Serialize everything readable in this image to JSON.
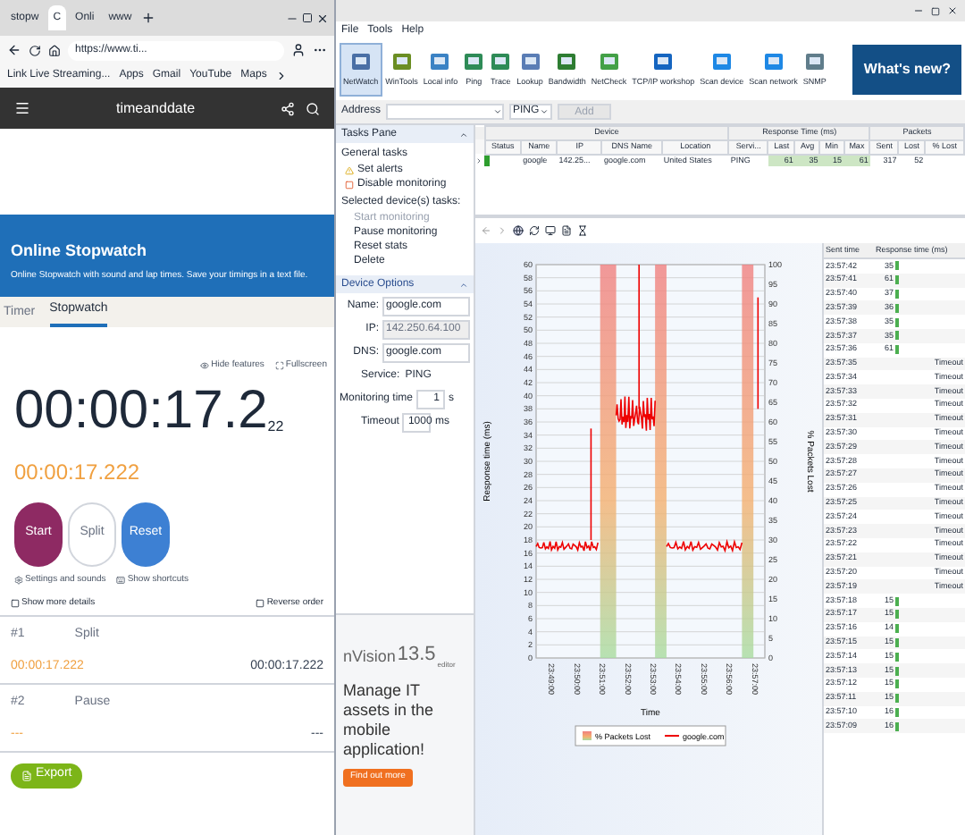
{
  "browser": {
    "tabs": [
      {
        "label": "stopw",
        "selected": false
      },
      {
        "label": "C",
        "selected": true
      },
      {
        "label": "Onli",
        "selected": false
      },
      {
        "label": "www",
        "selected": false
      }
    ],
    "address": "https://www.ti...",
    "bookmarks": [
      "Link Live Streaming...",
      "Apps",
      "Gmail",
      "YouTube",
      "Maps"
    ],
    "site_logo": "timeanddate"
  },
  "stopwatch": {
    "title": "Online Stopwatch",
    "subtitle": "Online Stopwatch with sound and lap times. Save your timings in a text file.",
    "tabs": [
      {
        "label": "Timer",
        "selected": false
      },
      {
        "label": "Stopwatch",
        "selected": true
      }
    ],
    "links": [
      "Hide features",
      "Fullscreen"
    ],
    "time": "00:00:17.2",
    "time_small": "22",
    "lap_time": "00:00:17.222",
    "buttons": [
      {
        "label": "Start",
        "kind": "start"
      },
      {
        "label": "Split",
        "kind": "split"
      },
      {
        "label": "Reset",
        "kind": "reset"
      }
    ],
    "settings_links": [
      "Settings and sounds",
      "Show shortcuts"
    ],
    "options": [
      {
        "label": "Show more details",
        "checked": false
      },
      {
        "label": "Reverse order",
        "checked": false
      }
    ],
    "laps": [
      {
        "number": "#1",
        "name": "Split",
        "time": "00:00:17.222",
        "total": "00:00:17.222"
      },
      {
        "number": "#2",
        "name": "Pause",
        "time": "---",
        "total": "---"
      }
    ],
    "export": "Export"
  },
  "app": {
    "menu": [
      "File",
      "Tools",
      "Help"
    ],
    "toolbar": [
      {
        "label": "NetWatch",
        "selected": true
      },
      {
        "label": "WinTools",
        "selected": false
      },
      {
        "label": "Local info",
        "selected": false
      },
      {
        "label": "Ping",
        "selected": false
      },
      {
        "label": "Trace",
        "selected": false
      },
      {
        "label": "Lookup",
        "selected": false
      },
      {
        "label": "Bandwidth",
        "selected": false
      },
      {
        "label": "NetCheck",
        "selected": false
      },
      {
        "label": "TCP/IP workshop",
        "selected": false
      },
      {
        "label": "Scan device",
        "selected": false
      },
      {
        "label": "Scan network",
        "selected": false
      },
      {
        "label": "SNMP",
        "selected": false
      }
    ],
    "whats_new": "What's new?",
    "address_label": "Address",
    "service": "PING",
    "add_button": "Add",
    "tasks": {
      "header": "Tasks Pane",
      "general": "General tasks",
      "general_items": [
        "Set alerts",
        "Disable monitoring"
      ],
      "selected": "Selected device(s) tasks:",
      "selected_items": [
        {
          "label": "Start monitoring",
          "disabled": true
        },
        {
          "label": "Pause monitoring",
          "disabled": false
        },
        {
          "label": "Reset stats",
          "disabled": false
        },
        {
          "label": "Delete",
          "disabled": false
        }
      ]
    },
    "options": {
      "header": "Device Options",
      "name_label": "Name:",
      "name": "google.com",
      "ip_label": "IP:",
      "ip": "142.250.64.100",
      "dns_label": "DNS:",
      "dns": "google.com",
      "service_label": "Service:",
      "service": "PING",
      "monitoring_label": "Monitoring time",
      "monitoring": "1",
      "monitoring_unit": "s",
      "timeout_label": "Timeout",
      "timeout": "1000",
      "timeout_unit": "ms"
    },
    "ad": {
      "brand": "nVision",
      "version": "13.5",
      "edition": "editor",
      "text": "Manage IT assets in the mobile application!",
      "button": "Find out more"
    },
    "device_table": {
      "groups": [
        "Device",
        "Response Time (ms)",
        "Packets"
      ],
      "columns": [
        "Status",
        "Name",
        "IP",
        "DNS Name",
        "Location",
        "Servi...",
        "Last",
        "Avg",
        "Min",
        "Max",
        "Sent",
        "Lost",
        "% Lost"
      ],
      "rows": [
        [
          "",
          "google",
          "142.25...",
          "google.com",
          "United States",
          "PING",
          "61",
          "35",
          "15",
          "61",
          "317",
          "52"
        ]
      ]
    },
    "chart": {
      "ylabel": "Response time (ms)",
      "y2label": "% Packets Lost",
      "xlabel": "Time",
      "yticks": [
        "60",
        "58",
        "56",
        "54",
        "52",
        "50",
        "48",
        "46",
        "44",
        "42",
        "40",
        "38",
        "36",
        "34",
        "32",
        "30",
        "28",
        "26",
        "24",
        "22",
        "20",
        "18",
        "16",
        "14",
        "12",
        "10",
        "8",
        "6",
        "4",
        "2",
        "0"
      ],
      "y2ticks": [
        "100",
        "95",
        "90",
        "85",
        "80",
        "75",
        "70",
        "65",
        "60",
        "55",
        "50",
        "45",
        "40",
        "35",
        "30",
        "25",
        "20",
        "15",
        "10",
        "5",
        "0"
      ],
      "xticks": [
        "23:49:00",
        "23:50:00",
        "23:51:00",
        "23:52:00",
        "23:53:00",
        "23:54:00",
        "23:55:00",
        "23:56:00",
        "23:57:00"
      ],
      "legend": [
        "% Packets Lost",
        "google.com"
      ]
    },
    "log": {
      "columns": [
        "Sent time",
        "Response time (ms)"
      ],
      "rows": [
        {
          "time": "23:57:42",
          "value": "35",
          "kind": "ok"
        },
        {
          "time": "23:57:41",
          "value": "61",
          "kind": "ok"
        },
        {
          "time": "23:57:40",
          "value": "37",
          "kind": "ok"
        },
        {
          "time": "23:57:39",
          "value": "36",
          "kind": "ok"
        },
        {
          "time": "23:57:38",
          "value": "35",
          "kind": "ok"
        },
        {
          "time": "23:57:37",
          "value": "35",
          "kind": "ok"
        },
        {
          "time": "23:57:36",
          "value": "61",
          "kind": "ok"
        },
        {
          "time": "23:57:35",
          "value": "Timeout",
          "kind": "timeout"
        },
        {
          "time": "23:57:34",
          "value": "Timeout",
          "kind": "timeout"
        },
        {
          "time": "23:57:33",
          "value": "Timeout",
          "kind": "timeout"
        },
        {
          "time": "23:57:32",
          "value": "Timeout",
          "kind": "timeout"
        },
        {
          "time": "23:57:31",
          "value": "Timeout",
          "kind": "timeout"
        },
        {
          "time": "23:57:30",
          "value": "Timeout",
          "kind": "timeout"
        },
        {
          "time": "23:57:29",
          "value": "Timeout",
          "kind": "timeout"
        },
        {
          "time": "23:57:28",
          "value": "Timeout",
          "kind": "timeout"
        },
        {
          "time": "23:57:27",
          "value": "Timeout",
          "kind": "timeout"
        },
        {
          "time": "23:57:26",
          "value": "Timeout",
          "kind": "timeout"
        },
        {
          "time": "23:57:25",
          "value": "Timeout",
          "kind": "timeout"
        },
        {
          "time": "23:57:24",
          "value": "Timeout",
          "kind": "timeout"
        },
        {
          "time": "23:57:23",
          "value": "Timeout",
          "kind": "timeout"
        },
        {
          "time": "23:57:22",
          "value": "Timeout",
          "kind": "timeout"
        },
        {
          "time": "23:57:21",
          "value": "Timeout",
          "kind": "timeout"
        },
        {
          "time": "23:57:20",
          "value": "Timeout",
          "kind": "timeout"
        },
        {
          "time": "23:57:19",
          "value": "Timeout",
          "kind": "timeout"
        },
        {
          "time": "23:57:18",
          "value": "15",
          "kind": "ok"
        },
        {
          "time": "23:57:17",
          "value": "15",
          "kind": "ok"
        },
        {
          "time": "23:57:16",
          "value": "14",
          "kind": "ok"
        },
        {
          "time": "23:57:15",
          "value": "15",
          "kind": "ok"
        },
        {
          "time": "23:57:14",
          "value": "15",
          "kind": "ok"
        },
        {
          "time": "23:57:13",
          "value": "15",
          "kind": "ok"
        },
        {
          "time": "23:57:12",
          "value": "15",
          "kind": "ok"
        },
        {
          "time": "23:57:11",
          "value": "15",
          "kind": "ok"
        },
        {
          "time": "23:57:10",
          "value": "16",
          "kind": "ok"
        },
        {
          "time": "23:57:09",
          "value": "16",
          "kind": "ok"
        }
      ]
    }
  }
}
